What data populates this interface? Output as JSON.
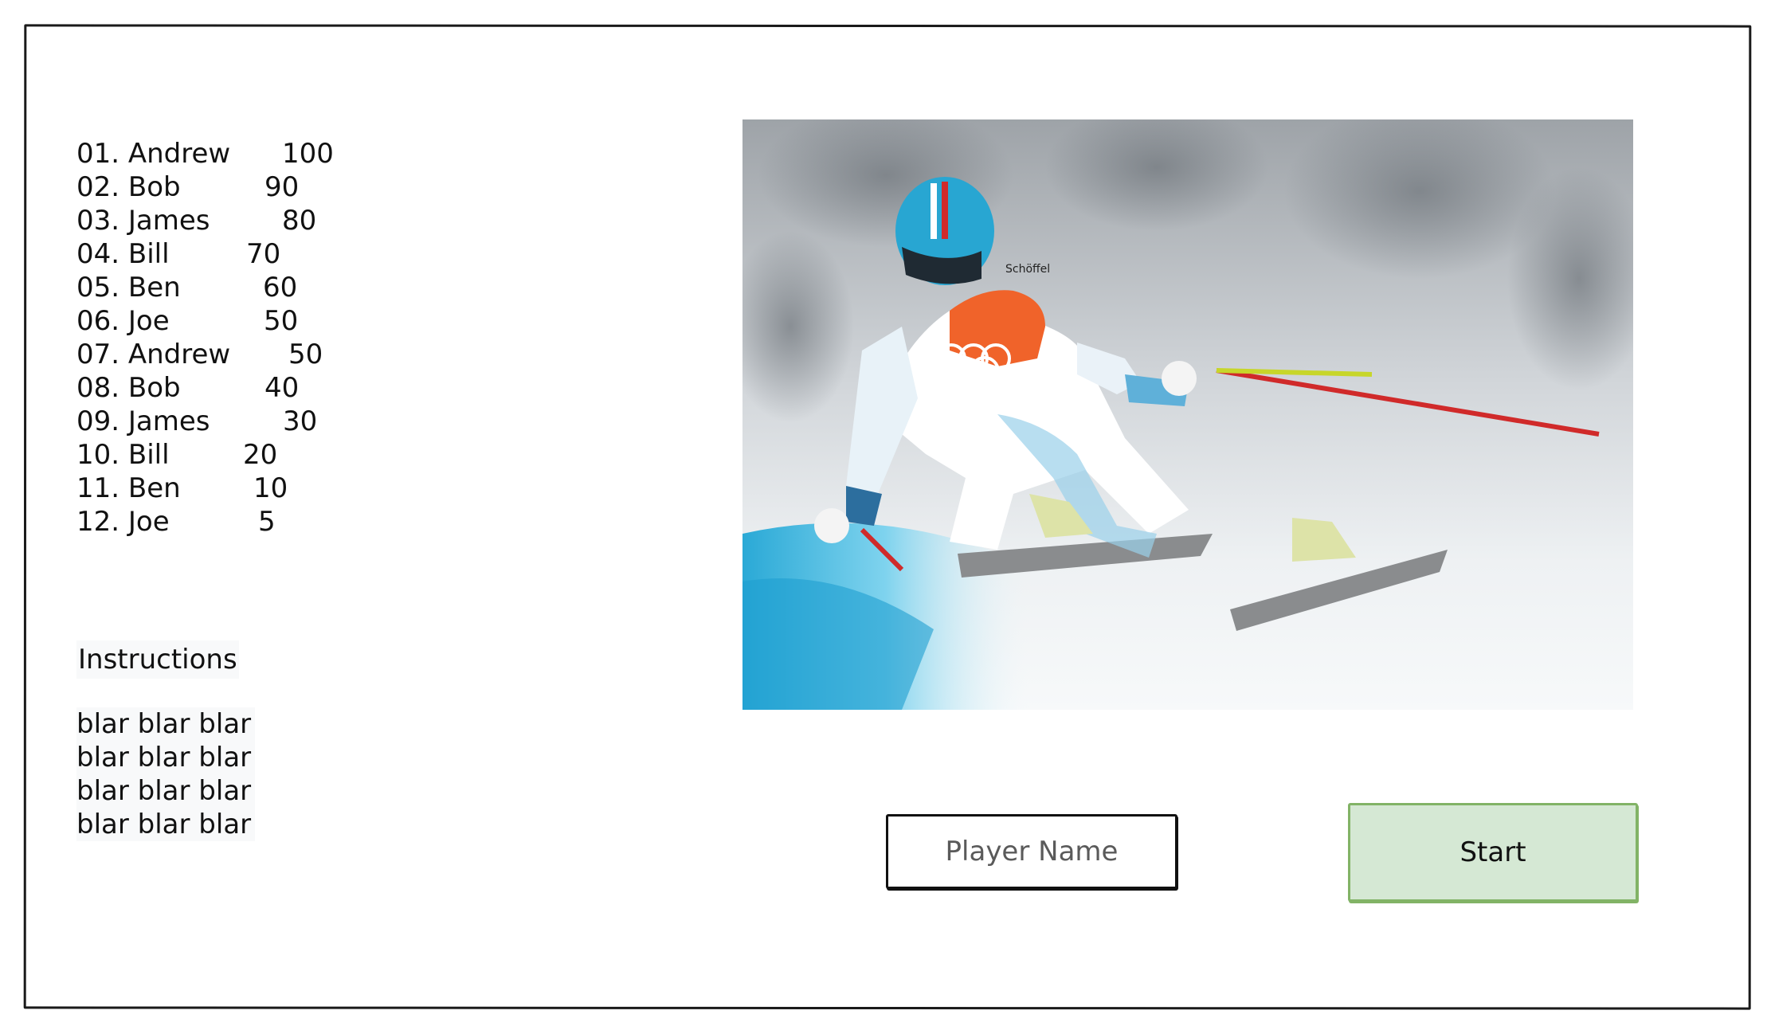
{
  "leaderboard": [
    {
      "rank_name": "01. Andrew",
      "score": "100"
    },
    {
      "rank_name": "02. Bob",
      "score": "90"
    },
    {
      "rank_name": "03. James",
      "score": "80"
    },
    {
      "rank_name": "04. Bill",
      "score": "70"
    },
    {
      "rank_name": "05. Ben",
      "score": "60"
    },
    {
      "rank_name": "06. Joe",
      "score": "50"
    },
    {
      "rank_name": "07. Andrew",
      "score": "50"
    },
    {
      "rank_name": "08. Bob",
      "score": "40"
    },
    {
      "rank_name": "09. James",
      "score": "30"
    },
    {
      "rank_name": "10. Bill",
      "score": "20"
    },
    {
      "rank_name": "11. Ben",
      "score": "10"
    },
    {
      "rank_name": "12. Joe",
      "score": "5"
    }
  ],
  "instructions": {
    "title": "Instructions",
    "lines": [
      "blar blar blar",
      "blar blar blar",
      "blar blar blar",
      "blar blar blar"
    ]
  },
  "player_input": {
    "placeholder": "Player Name",
    "value": ""
  },
  "start_button": {
    "label": "Start"
  },
  "hero_image": {
    "icon": "skier-photo",
    "bib_text": "Schöffel"
  },
  "colors": {
    "start_fill": "#d5e8d4",
    "start_border": "#82b366"
  }
}
